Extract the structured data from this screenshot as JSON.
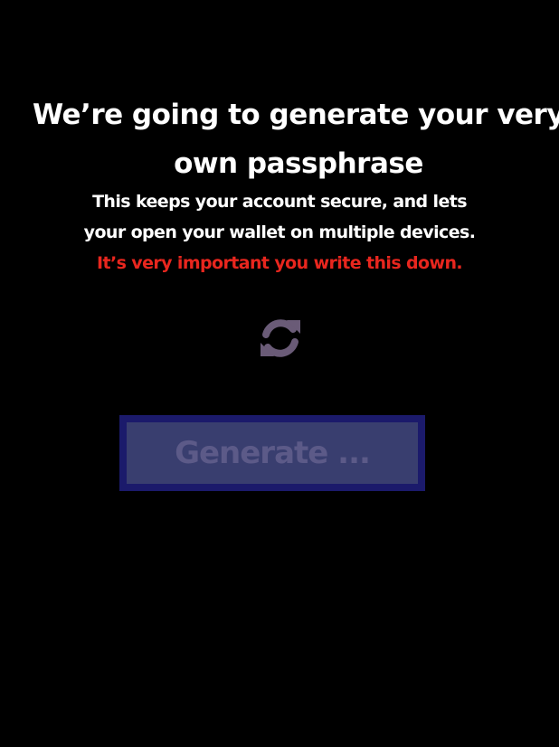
{
  "title": {
    "line1": "We’re going to generate your very",
    "line2": "own passphrase"
  },
  "description": {
    "line1": "This keeps your account secure, and lets",
    "line2": "your open your wallet on multiple devices."
  },
  "warning": "It’s very important you write this down.",
  "icons": {
    "refresh": "refresh-icon"
  },
  "buttons": {
    "generate": "Generate ..."
  },
  "colors": {
    "background": "#000000",
    "text": "#ffffff",
    "warning": "#e8261e",
    "icon": "#6a5b77",
    "button_fill": "#393e6f",
    "button_border": "#1b1a6b",
    "button_text": "#5c5a88"
  }
}
